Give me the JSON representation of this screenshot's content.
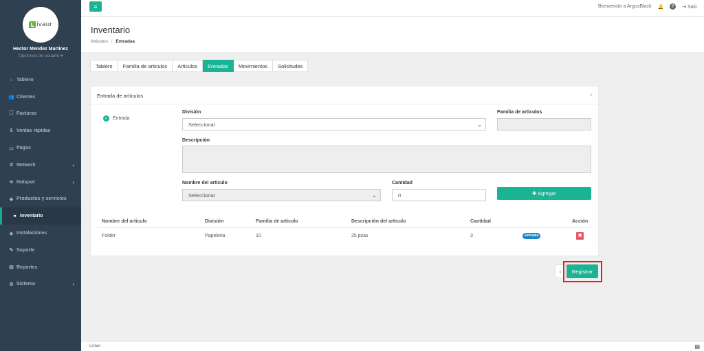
{
  "sidebar": {
    "logo_text": "ivaur",
    "logo_mark": "L",
    "user_name": "Hector Mendez Martinez",
    "user_options": "Opciones de usuario ▾",
    "items": [
      {
        "label": "Tablero",
        "icon": "⌂",
        "arrow": ""
      },
      {
        "label": "Clientes",
        "icon": "👥",
        "arrow": ""
      },
      {
        "label": "Facturas",
        "icon": "🗋",
        "arrow": ""
      },
      {
        "label": "Ventas rápidas",
        "icon": "$",
        "arrow": ""
      },
      {
        "label": "Pagos",
        "icon": "▭",
        "arrow": ""
      },
      {
        "label": "Network",
        "icon": "✲",
        "arrow": "‹"
      },
      {
        "label": "Hotspot",
        "icon": "≋",
        "arrow": "‹"
      },
      {
        "label": "Productos y servicios",
        "icon": "◆",
        "arrow": ""
      },
      {
        "label": "Inventario",
        "icon": "⚭",
        "arrow": ""
      },
      {
        "label": "Instalaciones",
        "icon": "◈",
        "arrow": ""
      },
      {
        "label": "Soporte",
        "icon": "✎",
        "arrow": ""
      },
      {
        "label": "Reportes",
        "icon": "▤",
        "arrow": ""
      },
      {
        "label": "Sistema",
        "icon": "⚙",
        "arrow": "‹"
      }
    ]
  },
  "topbar": {
    "menu_icon": "≡",
    "welcome": "Bienvenido a ArgusBlack",
    "bell_icon": "🔔",
    "help_icon": "?",
    "logout_icon": "⇥",
    "logout_label": "Salir"
  },
  "heading": {
    "title": "Inventario",
    "crumb_parent": "Articulos",
    "crumb_sep": "/",
    "crumb_active": "Entradas"
  },
  "tabs": [
    "Tablero",
    "Familia de articulos",
    "Articulos",
    "Entradas",
    "Movimientos",
    "Solicitudes"
  ],
  "panel": {
    "title": "Entrada de artículos",
    "close": "×",
    "type_label": "Entrada",
    "check_icon": "✓",
    "division_label": "División",
    "division_value": "Seleccionar",
    "familia_label": "Familia de articulos",
    "descripcion_label": "Descripción",
    "articulo_label": "Nombre del articulo",
    "articulo_value": "Seleccionar",
    "cantidad_label": "Cantidad",
    "cantidad_value": "0",
    "add_button": "✚ Agregar",
    "chevron": "⌄"
  },
  "table": {
    "headers": [
      "Nombre del articulo",
      "División",
      "Familia de articulo",
      "Descripción del articulo",
      "Cantidad",
      "Acción"
    ],
    "rows": [
      {
        "nombre": "Folder",
        "division": "Papeleria",
        "familia": "10",
        "descripcion": "25 pzas",
        "cantidad": "3",
        "badge": "Entrada",
        "delete": "✖"
      }
    ]
  },
  "actions": {
    "back": "‹",
    "register": "Registrar"
  },
  "footer": {
    "text": "Livaur",
    "icon": "▤"
  }
}
